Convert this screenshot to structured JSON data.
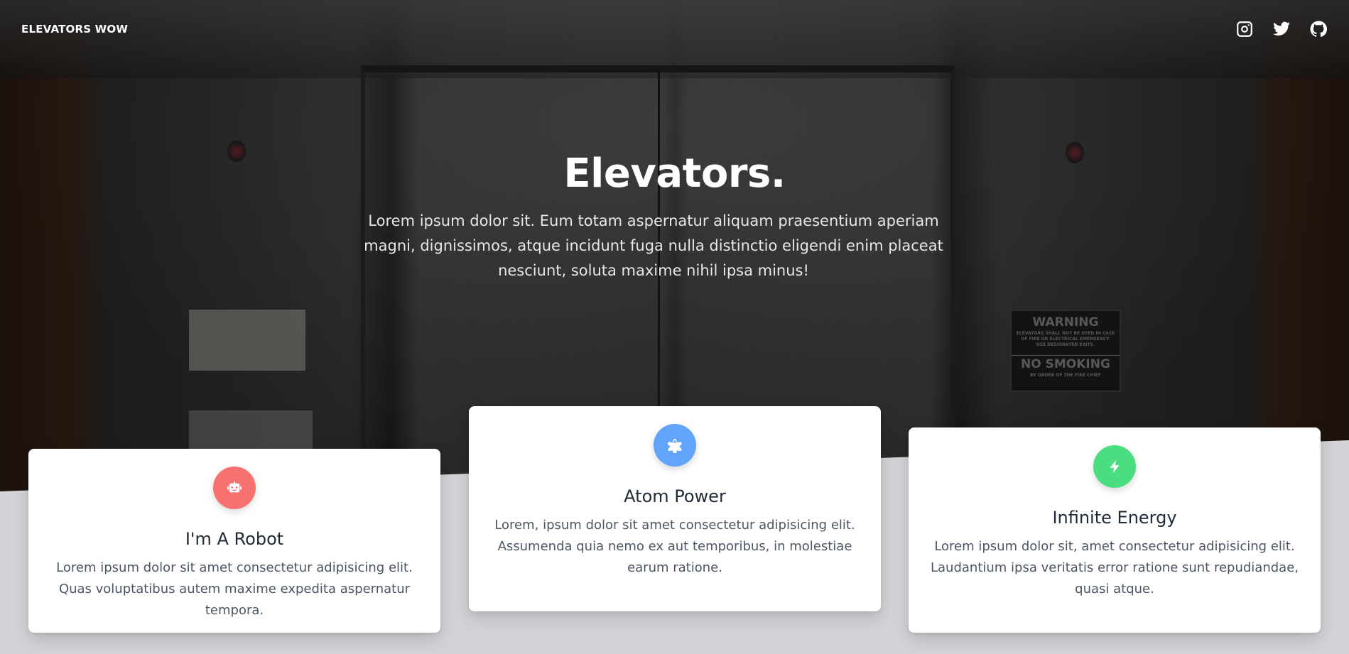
{
  "nav": {
    "brand": "ELEVATORS WOW",
    "social": [
      {
        "icon": "instagram-icon"
      },
      {
        "icon": "twitter-icon"
      },
      {
        "icon": "github-icon"
      }
    ]
  },
  "hero": {
    "title": "Elevators.",
    "description": "Lorem ipsum dolor sit. Eum totam aspernatur aliquam praesentium aperiam magni, dignissimos, atque incidunt fuga nulla distinctio eligendi enim placeat nesciunt, soluta maxime nihil ipsa minus!",
    "background_sign": {
      "warning": "WARNING",
      "fine_print": "ELEVATORS SHALL NOT BE USED IN CASE OF FIRE OR ELECTRICAL EMERGENCY. USE DESIGNATED EXITS.",
      "no_smoking": "NO SMOKING",
      "order": "BY ORDER OF THE FIRE CHIEF"
    }
  },
  "features": [
    {
      "icon": "robot-icon",
      "color": "#f87171",
      "title": "I'm A Robot",
      "text": "Lorem ipsum dolor sit amet consectetur adipisicing elit. Quas voluptatibus autem maxime expedita aspernatur tempora."
    },
    {
      "icon": "atom-icon",
      "color": "#60a5fa",
      "title": "Atom Power",
      "text": "Lorem, ipsum dolor sit amet consectetur adipisicing elit. Assumenda quia nemo ex aut temporibus, in molestiae earum ratione."
    },
    {
      "icon": "bolt-icon",
      "color": "#4ade80",
      "title": "Infinite Energy",
      "text": "Lorem ipsum dolor sit, amet consectetur adipisicing elit. Laudantium ipsa veritatis error ratione sunt repudiandae, quasi atque."
    }
  ],
  "colors": {
    "page_background": "#d4d4d8",
    "card_background": "#ffffff"
  }
}
